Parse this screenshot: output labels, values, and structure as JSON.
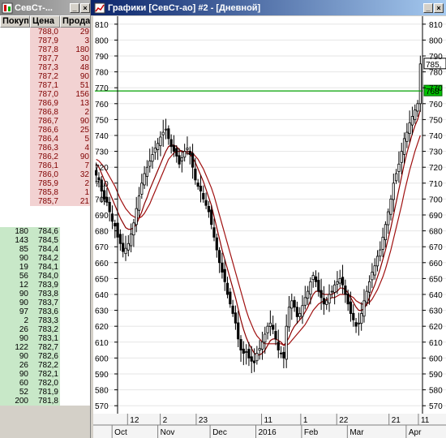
{
  "orderbook": {
    "title": "СевСт-...",
    "headers": {
      "bid": "Покупк",
      "price": "Цена",
      "ask": "Продаж"
    },
    "sell": [
      {
        "price": "788,0",
        "qty": "29"
      },
      {
        "price": "787,9",
        "qty": "3"
      },
      {
        "price": "787,8",
        "qty": "180"
      },
      {
        "price": "787,7",
        "qty": "30"
      },
      {
        "price": "787,3",
        "qty": "48"
      },
      {
        "price": "787,2",
        "qty": "90"
      },
      {
        "price": "787,1",
        "qty": "51"
      },
      {
        "price": "787,0",
        "qty": "156"
      },
      {
        "price": "786,9",
        "qty": "13"
      },
      {
        "price": "786,8",
        "qty": "2"
      },
      {
        "price": "786,7",
        "qty": "90"
      },
      {
        "price": "786,6",
        "qty": "25"
      },
      {
        "price": "786,4",
        "qty": "5"
      },
      {
        "price": "786,3",
        "qty": "4"
      },
      {
        "price": "786,2",
        "qty": "90"
      },
      {
        "price": "786,1",
        "qty": "7"
      },
      {
        "price": "786,0",
        "qty": "32"
      },
      {
        "price": "785,9",
        "qty": "2"
      },
      {
        "price": "785,8",
        "qty": "1"
      },
      {
        "price": "785,7",
        "qty": "21"
      }
    ],
    "buy": [
      {
        "qty": "180",
        "price": "784,6"
      },
      {
        "qty": "143",
        "price": "784,5"
      },
      {
        "qty": "85",
        "price": "784,4"
      },
      {
        "qty": "90",
        "price": "784,2"
      },
      {
        "qty": "19",
        "price": "784,1"
      },
      {
        "qty": "56",
        "price": "784,0"
      },
      {
        "qty": "12",
        "price": "783,9"
      },
      {
        "qty": "90",
        "price": "783,8"
      },
      {
        "qty": "90",
        "price": "783,7"
      },
      {
        "qty": "97",
        "price": "783,6"
      },
      {
        "qty": "2",
        "price": "783,3"
      },
      {
        "qty": "26",
        "price": "783,2"
      },
      {
        "qty": "90",
        "price": "783,1"
      },
      {
        "qty": "122",
        "price": "782,7"
      },
      {
        "qty": "90",
        "price": "782,6"
      },
      {
        "qty": "26",
        "price": "782,2"
      },
      {
        "qty": "90",
        "price": "782,1"
      },
      {
        "qty": "60",
        "price": "782,0"
      },
      {
        "qty": "52",
        "price": "781,9"
      },
      {
        "qty": "200",
        "price": "781,8"
      }
    ]
  },
  "chart_window": {
    "title": "Графики [СевСт-ао] #2 - [Дневной]",
    "last_price_label": "785,",
    "level_label": "768"
  },
  "colors": {
    "candle": "#000000",
    "ma_fast": "#8b0000",
    "ma_slow": "#a01010",
    "level_line": "#00a000",
    "level_badge": "#00c000",
    "sell_bg": "#f2d2d2",
    "buy_bg": "#c8e8c8"
  },
  "chart_data": {
    "type": "candlestick",
    "ylim": [
      565,
      815
    ],
    "yticks": [
      570,
      580,
      590,
      600,
      610,
      620,
      630,
      640,
      650,
      660,
      670,
      680,
      690,
      700,
      710,
      720,
      730,
      740,
      750,
      760,
      770,
      780,
      790,
      800,
      810
    ],
    "horizontal_level": 768,
    "last_price": 785,
    "closes": [
      715,
      712,
      705,
      700,
      698,
      692,
      686,
      683,
      676,
      672,
      667,
      669,
      672,
      678,
      685,
      694,
      702,
      710,
      716,
      720,
      724,
      728,
      732,
      735,
      739,
      742,
      744,
      738,
      733,
      730,
      727,
      722,
      726,
      730,
      732,
      728,
      720,
      712,
      708,
      705,
      700,
      696,
      692,
      684,
      676,
      668,
      660,
      654,
      648,
      640,
      634,
      628,
      622,
      612,
      605,
      603,
      604,
      600,
      598,
      597,
      603,
      606,
      610,
      615,
      620,
      622,
      618,
      612,
      605,
      603,
      600,
      620,
      632,
      636,
      632,
      626,
      628,
      633,
      638,
      642,
      648,
      652,
      648,
      642,
      638,
      634,
      636,
      640,
      642,
      646,
      648,
      650,
      646,
      640,
      634,
      628,
      624,
      620,
      622,
      628,
      636,
      642,
      648,
      654,
      658,
      664,
      668,
      676,
      684,
      692,
      700,
      710,
      716,
      722,
      730,
      738,
      742,
      748,
      752,
      756,
      760,
      785
    ],
    "ma_fast": [
      722,
      720,
      716,
      712,
      708,
      704,
      700,
      696,
      692,
      688,
      685,
      682,
      681,
      681,
      682,
      684,
      688,
      692,
      697,
      701,
      706,
      710,
      714,
      718,
      722,
      726,
      730,
      733,
      734,
      734,
      733,
      731,
      730,
      729,
      729,
      728,
      726,
      723,
      719,
      715,
      711,
      706,
      701,
      696,
      689,
      682,
      675,
      668,
      662,
      656,
      650,
      644,
      638,
      631,
      624,
      618,
      613,
      609,
      606,
      603,
      602,
      602,
      603,
      605,
      608,
      611,
      612,
      612,
      611,
      610,
      608,
      610,
      613,
      617,
      620,
      622,
      624,
      626,
      629,
      632,
      636,
      640,
      642,
      642,
      641,
      640,
      640,
      640,
      640,
      641,
      642,
      644,
      644,
      643,
      641,
      638,
      635,
      632,
      630,
      630,
      631,
      634,
      638,
      642,
      646,
      651,
      656,
      662,
      668,
      675,
      682,
      690,
      698,
      706,
      714,
      722,
      729,
      735,
      741,
      746,
      750,
      756
    ],
    "ma_slow": [
      725,
      724,
      722,
      720,
      717,
      714,
      711,
      708,
      704,
      700,
      697,
      694,
      692,
      690,
      689,
      688,
      688,
      689,
      691,
      694,
      697,
      701,
      705,
      709,
      713,
      717,
      721,
      725,
      727,
      729,
      730,
      730,
      730,
      730,
      730,
      730,
      729,
      727,
      725,
      722,
      719,
      715,
      711,
      707,
      702,
      696,
      690,
      684,
      678,
      672,
      666,
      660,
      654,
      648,
      642,
      636,
      630,
      625,
      621,
      617,
      614,
      612,
      610,
      609,
      609,
      609,
      609,
      609,
      609,
      609,
      608,
      608,
      609,
      611,
      613,
      615,
      617,
      619,
      621,
      624,
      627,
      630,
      632,
      634,
      635,
      636,
      637,
      637,
      638,
      638,
      639,
      640,
      640,
      640,
      640,
      639,
      638,
      636,
      635,
      634,
      634,
      634,
      635,
      637,
      640,
      643,
      647,
      651,
      656,
      662,
      668,
      675,
      682,
      689,
      696,
      704,
      711,
      718,
      724,
      730,
      735,
      740
    ],
    "x_tick_labels": [
      {
        "text": "12",
        "at": 0.1
      },
      {
        "text": "2",
        "at": 0.2
      },
      {
        "text": "23",
        "at": 0.31
      },
      {
        "text": "11",
        "at": 0.51
      },
      {
        "text": "1",
        "at": 0.63
      },
      {
        "text": "22",
        "at": 0.74
      },
      {
        "text": "21",
        "at": 0.9
      },
      {
        "text": "11",
        "at": 0.99
      }
    ],
    "x_month_labels": [
      {
        "text": "Oct",
        "at": 0.06
      },
      {
        "text": "Nov",
        "at": 0.2
      },
      {
        "text": "Dec",
        "at": 0.36
      },
      {
        "text": "2016",
        "at": 0.5
      },
      {
        "text": "Feb",
        "at": 0.64
      },
      {
        "text": "Mar",
        "at": 0.78
      },
      {
        "text": "Apr",
        "at": 0.96
      }
    ]
  }
}
